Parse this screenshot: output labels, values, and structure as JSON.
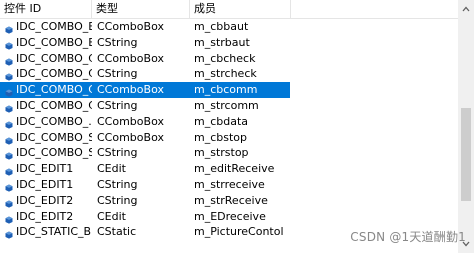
{
  "list": {
    "columns": [
      "控件 ID",
      "类型",
      "成员"
    ],
    "rows": [
      {
        "id": "IDC_COMBO_B...",
        "type": "CComboBox",
        "member": "m_cbbaut",
        "selected": false
      },
      {
        "id": "IDC_COMBO_B...",
        "type": "CString",
        "member": "m_strbaut",
        "selected": false
      },
      {
        "id": "IDC_COMBO_C...",
        "type": "CComboBox",
        "member": "m_cbcheck",
        "selected": false
      },
      {
        "id": "IDC_COMBO_C...",
        "type": "CString",
        "member": "m_strcheck",
        "selected": false
      },
      {
        "id": "IDC_COMBO_C...",
        "type": "CComboBox",
        "member": "m_cbcomm",
        "selected": true
      },
      {
        "id": "IDC_COMBO_C...",
        "type": "CString",
        "member": "m_strcomm",
        "selected": false
      },
      {
        "id": "IDC_COMBO_...",
        "type": "CComboBox",
        "member": "m_cbdata",
        "selected": false
      },
      {
        "id": "IDC_COMBO_S...",
        "type": "CComboBox",
        "member": "m_cbstop",
        "selected": false
      },
      {
        "id": "IDC_COMBO_S...",
        "type": "CString",
        "member": "m_strstop",
        "selected": false
      },
      {
        "id": "IDC_EDIT1",
        "type": "CEdit",
        "member": "m_editReceive",
        "selected": false
      },
      {
        "id": "IDC_EDIT1",
        "type": "CString",
        "member": "m_strreceive",
        "selected": false
      },
      {
        "id": "IDC_EDIT2",
        "type": "CString",
        "member": "m_strReceive",
        "selected": false
      },
      {
        "id": "IDC_EDIT2",
        "type": "CEdit",
        "member": "m_EDreceive",
        "selected": false
      },
      {
        "id": "IDC_STATIC_BI...",
        "type": "CStatic",
        "member": "m_PictureContol",
        "selected": false
      }
    ]
  },
  "scrollbar": {
    "position": 0.72,
    "thumb_fraction": 0.42
  },
  "watermark": "CSDN @1天道酬勤1",
  "colors": {
    "selection": "#0078d7",
    "icon_blue": "#1e5fb4"
  },
  "icons": {
    "row": "variable-icon",
    "scroll_down": "chevron-down-icon",
    "scroll_up": "chevron-up-icon"
  }
}
